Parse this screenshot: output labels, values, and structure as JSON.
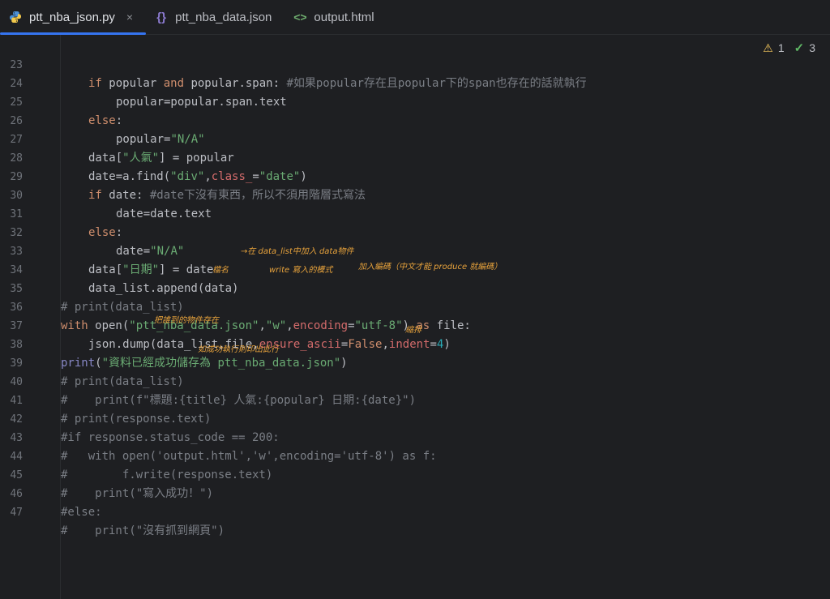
{
  "tabs": [
    {
      "label": "ptt_nba_json.py",
      "icon": "python-file-icon",
      "active": true,
      "close": "×"
    },
    {
      "label": "ptt_nba_data.json",
      "icon": "json-file-icon",
      "active": false
    },
    {
      "label": "output.html",
      "icon": "html-file-icon",
      "active": false
    }
  ],
  "inspections": {
    "warnings": "1",
    "ok": "3"
  },
  "lines": [
    {
      "n": "23"
    },
    {
      "n": "24"
    },
    {
      "n": "25"
    },
    {
      "n": "26"
    },
    {
      "n": "27"
    },
    {
      "n": "28"
    },
    {
      "n": "29"
    },
    {
      "n": "30"
    },
    {
      "n": "31"
    },
    {
      "n": "32"
    },
    {
      "n": "33"
    },
    {
      "n": "34"
    },
    {
      "n": "35"
    },
    {
      "n": "36"
    },
    {
      "n": "37"
    },
    {
      "n": "38"
    },
    {
      "n": "39"
    },
    {
      "n": "40"
    },
    {
      "n": "41"
    },
    {
      "n": "42"
    },
    {
      "n": "43"
    },
    {
      "n": "44"
    },
    {
      "n": "45"
    },
    {
      "n": "46"
    },
    {
      "n": "47"
    }
  ],
  "code": {
    "l23": {
      "kw1": "if",
      "a": " popular ",
      "kw2": "and",
      "b": " popular.span: ",
      "cmt": "#如果popular存在且popular下的span也存在的話就執行"
    },
    "l24": {
      "text": "popular=popular.span.text"
    },
    "l25": {
      "kw": "else",
      "text": ":"
    },
    "l26": {
      "a": "popular=",
      "str": "\"N/A\""
    },
    "l27": {
      "a": "data[",
      "str": "\"人氣\"",
      "b": "] = popular"
    },
    "l28": {
      "a": "date=a.find(",
      "s1": "\"div\"",
      "c": ",",
      "p": "class_",
      "d": "=",
      "s2": "\"date\"",
      "e": ")"
    },
    "l29": {
      "kw": "if",
      "a": " date: ",
      "cmt": "#date下沒有東西，所以不須用階層式寫法"
    },
    "l30": {
      "text": "date=date.text"
    },
    "l31": {
      "kw": "else",
      "text": ":"
    },
    "l32": {
      "a": "date=",
      "str": "\"N/A\""
    },
    "l33": {
      "a": "data[",
      "str": "\"日期\"",
      "b": "] = date"
    },
    "l34": {
      "text": "data_list.append(data)"
    },
    "l35": {
      "cmt": "# print(data_list)"
    },
    "l36": {
      "kw1": "with",
      "a": " open(",
      "s1": "\"ptt_nba_data.json\"",
      "c": ",",
      "s2": "\"w\"",
      "d": ",",
      "p": "encoding",
      "e": "=",
      "s3": "\"utf-8\"",
      "f": ") ",
      "kw2": "as",
      "g": " file:"
    },
    "l37": {
      "a": "json.dump(data_list,file,",
      "p1": "ensure_ascii",
      "b": "=",
      "kw": "False",
      "c": ",",
      "p2": "indent",
      "d": "=",
      "num": "4",
      "e": ")"
    },
    "l38": {
      "bi": "print",
      "a": "(",
      "str": "\"資料已經成功儲存為 ptt_nba_data.json\"",
      "b": ")"
    },
    "l39": {
      "cmt": "# print(data_list)"
    },
    "l40": {
      "cmt": "#    print(f\"標題:{title} 人氣:{popular} 日期:{date}\")"
    },
    "l41": {
      "cmt": "# print(response.text)"
    },
    "l42": {
      "cmt": "#if response.status_code == 200:"
    },
    "l43": {
      "cmt": "#   with open('output.html','w',encoding='utf-8') as f:"
    },
    "l44": {
      "cmt": "#        f.write(response.text)"
    },
    "l45": {
      "cmt": "#    print(\"寫入成功！\")"
    },
    "l46": {
      "cmt": "#else:"
    },
    "l47": {
      "cmt": "#    print(\"沒有抓到網頁\")"
    }
  },
  "annotations": {
    "a34": "→在 data_list中加入 data物件",
    "a36_name": "檔名",
    "a36_write": "write 寫入的模式",
    "a36_enc": "加入編碼（中文才能 produce 就編碼）",
    "a37": "把誰到的物件存在",
    "a37_indent": "縮排",
    "a38": "如成功執行則印出此行"
  }
}
